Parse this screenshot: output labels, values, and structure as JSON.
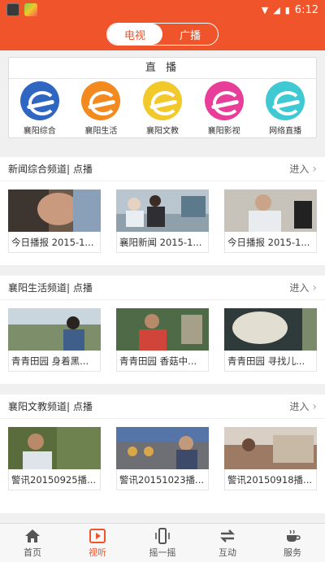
{
  "status_bar": {
    "time": "6:12"
  },
  "tabs": {
    "tv": "电视",
    "radio": "广播",
    "active": "tv"
  },
  "live": {
    "title": "直 播",
    "channels": [
      {
        "name": "襄阳综合",
        "color": "#2f66c2"
      },
      {
        "name": "襄阳生活",
        "color": "#f28a1f"
      },
      {
        "name": "襄阳文教",
        "color": "#f2c92a"
      },
      {
        "name": "襄阳影视",
        "color": "#e93d9a"
      },
      {
        "name": "网络直播",
        "color": "#3fc9d3"
      }
    ]
  },
  "sections": [
    {
      "title": "新闻综合频道| 点播",
      "more": "进入",
      "items": [
        {
          "caption": "今日播报 2015-1..."
        },
        {
          "caption": "襄阳新闻 2015-1..."
        },
        {
          "caption": "今日播报 2015-1..."
        }
      ]
    },
    {
      "title": "襄阳生活频道| 点播",
      "more": "进入",
      "items": [
        {
          "caption": "青青田园 身着黑..."
        },
        {
          "caption": "青青田园 香菇中..."
        },
        {
          "caption": "青青田园 寻找儿..."
        }
      ]
    },
    {
      "title": "襄阳文教频道| 点播",
      "more": "进入",
      "items": [
        {
          "caption": "警讯20150925播..."
        },
        {
          "caption": "警讯20151023播..."
        },
        {
          "caption": "警讯20150918播..."
        }
      ]
    }
  ],
  "bottom_nav": [
    {
      "label": "首页",
      "icon": "home-icon"
    },
    {
      "label": "视听",
      "icon": "play-icon",
      "active": true
    },
    {
      "label": "摇一摇",
      "icon": "shake-phone-icon"
    },
    {
      "label": "互动",
      "icon": "swap-arrows-icon"
    },
    {
      "label": "服务",
      "icon": "coffee-cup-icon"
    }
  ],
  "colors": {
    "brand": "#f0542a"
  }
}
